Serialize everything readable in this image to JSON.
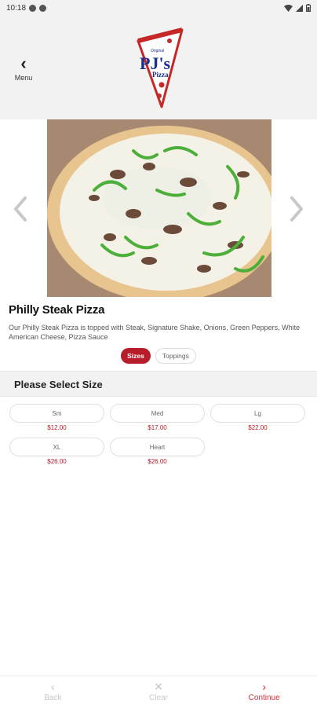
{
  "status_bar": {
    "time": "10:18"
  },
  "header": {
    "menu_label": "Menu",
    "logo_top": "Original",
    "logo_main": "PJ's",
    "logo_sub": "Pizza"
  },
  "product": {
    "title": "Philly Steak Pizza",
    "description": "Our Philly Steak Pizza is topped with Steak, Signature Shake, Onions, Green Peppers, White American Cheese, Pizza Sauce"
  },
  "tabs": [
    {
      "label": "Sizes",
      "active": true
    },
    {
      "label": "Toppings",
      "active": false
    }
  ],
  "section": {
    "title": "Please Select Size"
  },
  "sizes": [
    {
      "label": "Sm",
      "price": "$12.00"
    },
    {
      "label": "Med",
      "price": "$17.00"
    },
    {
      "label": "Lg",
      "price": "$22.00"
    },
    {
      "label": "XL",
      "price": "$26.00"
    },
    {
      "label": "Heart",
      "price": "$26.00"
    }
  ],
  "bottom_bar": {
    "back": "Back",
    "clear": "Clear",
    "continue": "Continue"
  },
  "colors": {
    "accent": "#b71c2a",
    "logo_blue": "#1b2f8f",
    "header_bg": "#f2f2f2"
  }
}
